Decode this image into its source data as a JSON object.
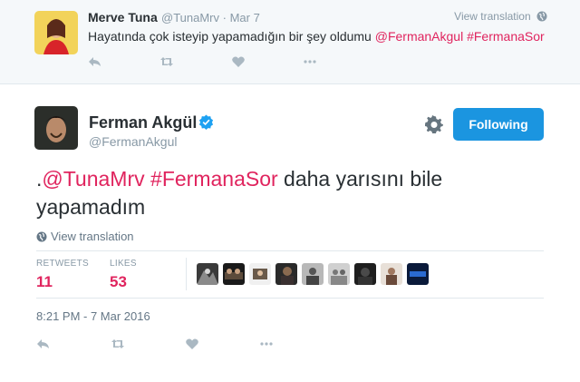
{
  "reply_tweet": {
    "name": "Merve Tuna",
    "handle": "@TunaMrv",
    "date": "· Mar 7",
    "view_translation": "View translation",
    "text_plain": "Hayatında çok isteyip yapamadığın bir şey oldumu ",
    "mention": "@FermanAkgul",
    "hashtag": "#FermanaSor",
    "icons": [
      "reply-icon",
      "retweet-icon",
      "like-icon",
      "more-icon"
    ]
  },
  "main_tweet": {
    "name": "Ferman Akgül",
    "handle": "@FermanAkgul",
    "follow_label": "Following",
    "text_prefix": ".",
    "mention": "@TunaMrv",
    "hashtag": "#FermanaSor",
    "text_rest": " daha yarısını bile yapamadım",
    "view_translation": "View translation",
    "stats": {
      "retweets_label": "RETWEETS",
      "retweets": "11",
      "likes_label": "LIKES",
      "likes": "53"
    },
    "liker_count": 9,
    "timestamp": "8:21 PM - 7 Mar 2016",
    "icons": [
      "reply-icon",
      "retweet-icon",
      "like-icon",
      "more-icon",
      "gear-icon",
      "verified-icon",
      "globe-icon"
    ]
  },
  "colors": {
    "link": "#e0245e",
    "follow_button": "#1b95e0",
    "muted": "#8899a6",
    "reply_background": "#f5f8fa"
  }
}
